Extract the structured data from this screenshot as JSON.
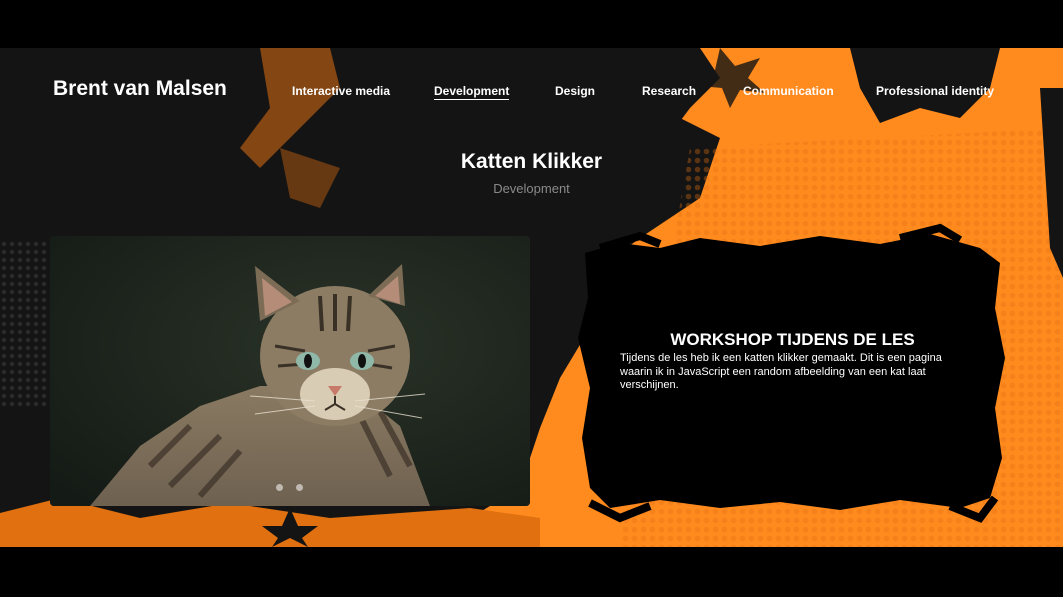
{
  "brand": "Brent van Malsen",
  "nav": {
    "items": [
      {
        "label": "Interactive media",
        "active": false
      },
      {
        "label": "Development",
        "active": true
      },
      {
        "label": "Design",
        "active": false
      },
      {
        "label": "Research",
        "active": false
      },
      {
        "label": "Communication",
        "active": false
      },
      {
        "label": "Professional identity",
        "active": false
      }
    ]
  },
  "page": {
    "title": "Katten Klikker",
    "category": "Development"
  },
  "carousel": {
    "image_subject": "tabby wildcat photo",
    "slide_count": 2,
    "active_slide": 1
  },
  "info": {
    "title": "WORKSHOP TIJDENS DE LES",
    "text": "Tijdens de les heb ik een katten klikker gemaakt. Dit is een pagina waarin ik in JavaScript een random afbeelding van een kat laat verschijnen."
  },
  "colors": {
    "accent": "#ff8a1e",
    "background": "#141414",
    "text": "#ffffff",
    "muted": "#8a8a8a"
  }
}
